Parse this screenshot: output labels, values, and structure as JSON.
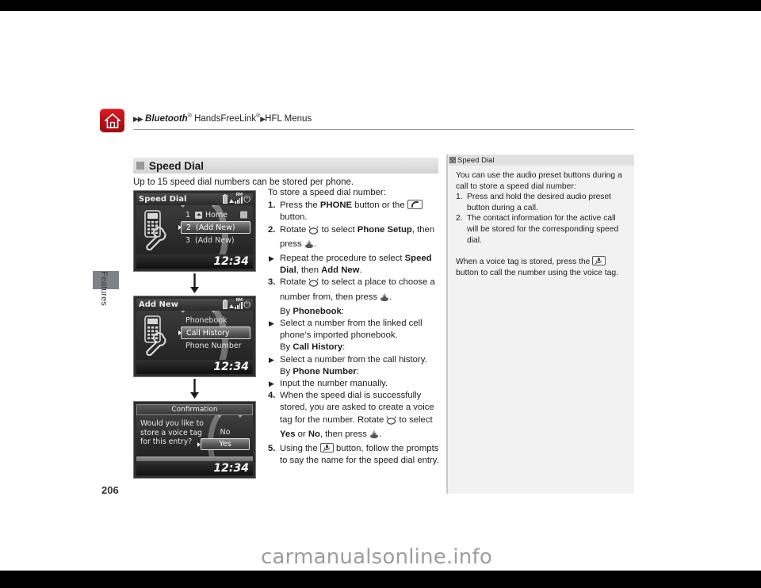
{
  "page": {
    "number": "206",
    "rail_label": "Features",
    "watermark": "carmanualsonline.info"
  },
  "header": {
    "home_icon": "home-icon",
    "breadcrumb": {
      "arrow1": "▶",
      "arrow2": "▶",
      "part1": "Bluetooth",
      "sup1": "®",
      "part2": "HandsFreeLink",
      "sup2": "®",
      "arrow3": "▶",
      "part3": "HFL Menus"
    }
  },
  "section": {
    "title": "Speed Dial",
    "intro": "Up to 15 speed dial numbers can be stored per phone."
  },
  "body": {
    "lead": "To store a speed dial number:",
    "steps": [
      {
        "num": "1.",
        "text_a": "Press the ",
        "bold_a": "PHONE",
        "text_b": " button or the ",
        "icon": "phone-handset-button-icon",
        "text_c": " button."
      },
      {
        "num": "2.",
        "text_a": "Rotate ",
        "icon_a": "rotary-knob-icon",
        "text_b": " to select ",
        "bold_a": "Phone Setup",
        "text_c": ", then press ",
        "icon_b": "enter-knob-press-icon",
        "text_d": "."
      }
    ],
    "step2_sub": {
      "arrow": "▶",
      "text_a": "Repeat the procedure to select ",
      "bold_a": "Speed Dial",
      "text_b": ", then ",
      "bold_b": "Add New",
      "text_c": "."
    },
    "step3": {
      "num": "3.",
      "text_a": "Rotate ",
      "icon_a": "rotary-knob-icon",
      "text_b": " to select a place to choose a number from, then press ",
      "icon_b": "enter-knob-press-icon",
      "text_c": "."
    },
    "by_blocks": [
      {
        "by": "By ",
        "bold": "Phonebook",
        "colon": ":",
        "arrow": "▶",
        "detail": "Select a number from the linked cell phone’s imported phonebook."
      },
      {
        "by": "By ",
        "bold": "Call History",
        "colon": ":",
        "arrow": "▶",
        "detail": "Select a number from the call history."
      },
      {
        "by": "By ",
        "bold": "Phone Number",
        "colon": ":",
        "arrow": "▶",
        "detail": "Input the number manually."
      }
    ],
    "step4": {
      "num": "4.",
      "text_a": "When the speed dial is successfully stored, you are asked to create a voice tag for the number. Rotate ",
      "icon_a": "rotary-knob-icon",
      "text_b": " to select ",
      "bold_a": "Yes",
      "text_c": " or ",
      "bold_b": "No",
      "text_d": ", then press ",
      "icon_b": "enter-knob-press-icon",
      "text_e": "."
    },
    "step5": {
      "num": "5.",
      "text_a": "Using the ",
      "icon": "talk-voice-button-icon",
      "text_b": " button, follow the prompts to say the name for the speed dial entry."
    }
  },
  "sidebar": {
    "marker_icon": "note-marker-icon",
    "title": "Speed Dial",
    "intro": "You can use the audio preset buttons during a call to store a speed dial number:",
    "items": [
      {
        "num": "1.",
        "text": "Press and hold the desired audio preset button during a call."
      },
      {
        "num": "2.",
        "text": "The contact information for the active call will be stored for the corresponding speed dial."
      }
    ],
    "footer_a": "When a voice tag is stored, press the ",
    "footer_icon": "talk-voice-button-icon",
    "footer_b": " button to call the number using the voice tag."
  },
  "figures": {
    "arrow_icon": "down-arrow-icon",
    "screen1": {
      "title": "Speed Dial",
      "status_icons": [
        "battery-icon",
        "signal-bars-icon",
        "roaming-label",
        "bluetooth-icon"
      ],
      "roaming": "RM",
      "big_icon": "phone-setup-wrench-icon",
      "rows": [
        {
          "index": "1",
          "label": "Home",
          "selected": false,
          "has_home_icon": true,
          "has_tag_icon": true
        },
        {
          "index": "2",
          "label": "(Add New)",
          "selected": true,
          "has_home_icon": false,
          "has_tag_icon": false
        },
        {
          "index": "3",
          "label": "(Add New)",
          "selected": false,
          "has_home_icon": false,
          "has_tag_icon": false
        }
      ],
      "clock": "12:34"
    },
    "screen2": {
      "title": "Add New",
      "roaming": "RM",
      "big_icon": "phone-setup-wrench-icon",
      "rows": [
        {
          "label": "Phonebook",
          "selected": false
        },
        {
          "label": "Call History",
          "selected": true
        },
        {
          "label": "Phone Number",
          "selected": false
        }
      ],
      "clock": "12:34"
    },
    "screen3": {
      "title": "Confirmation",
      "message": "Would you like to store a voice tag for this entry?",
      "options": [
        {
          "label": "No",
          "selected": false
        },
        {
          "label": "Yes",
          "selected": true
        }
      ],
      "clock": "12:34"
    }
  }
}
